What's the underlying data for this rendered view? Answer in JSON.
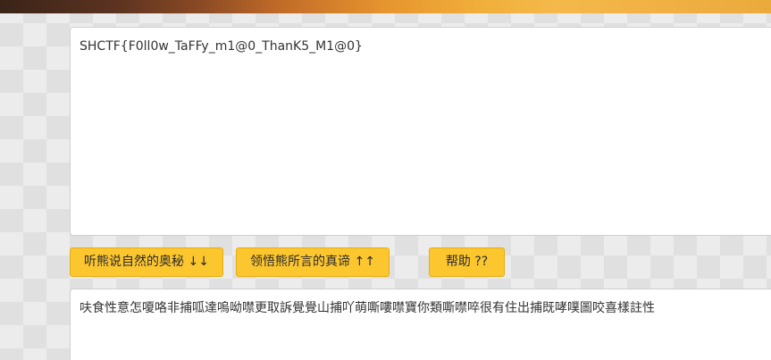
{
  "input": {
    "value": "SHCTF{F0ll0w_TaFFy_m1@0_ThanK5_M1@0}"
  },
  "buttons": {
    "decode_label": "听熊说自然的奥秘 ↓↓",
    "encode_label": "领悟熊所言的真谛 ↑↑",
    "help_label": "帮助 ??"
  },
  "output": {
    "value": "呋食性意怎嗄咯非捕呱達嗚呦噤更取訴覺覺山捕吖萌嘶嘍噤寶你類嘶噤啐很有住出捕既哮噗圖咬喜樣註性"
  },
  "colors": {
    "button": "#fcc62f",
    "background": "#ececec"
  }
}
